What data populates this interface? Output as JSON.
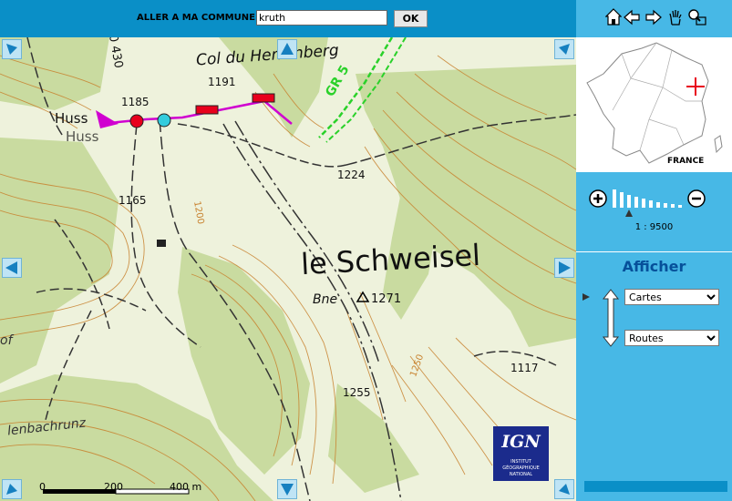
{
  "search": {
    "label": "ALLER A MA COMMUNE:",
    "value": "kruth",
    "ok_label": "OK"
  },
  "map": {
    "place_labels": {
      "col_du_herrenberg": "Col du Herrenberg",
      "le_schweisel": "le Schweisel",
      "bne": "Bne",
      "huss": "Huss",
      "huss2": "Huss",
      "gr5": "GR 5",
      "lenbachrunz": "lenbachrunz",
      "of": "of"
    },
    "elevations": {
      "e1185": "1185",
      "e1191": "1191",
      "e1224": "1224",
      "e1165": "1165",
      "e1271": "1271",
      "e1255": "1255",
      "e1117": "1117",
      "e1200": "1200",
      "e1250": "1250",
      "e430": "0 430"
    },
    "scalebar": {
      "l0": "0",
      "l200": "200",
      "l400": "400 m"
    },
    "ign": {
      "logo": "IGN",
      "line1": "INSTITUT",
      "line2": "GÉOGRAPHIQUE",
      "line3": "NATIONAL"
    }
  },
  "sidebar": {
    "overview_label": "FRANCE",
    "scale": "1 : 9500",
    "afficher_title": "Afficher",
    "layer1": {
      "selected": "Cartes",
      "options": [
        "Cartes"
      ]
    },
    "layer2": {
      "selected": "Routes",
      "options": [
        "Routes"
      ]
    }
  },
  "colors": {
    "topbar": "#0a8fc7",
    "sidebar": "#47b8e6",
    "forest": "#c9dba0",
    "contour": "#c8822f",
    "route_red": "#e8001c",
    "trail_magenta": "#d000d0",
    "gr_green": "#2ad12a",
    "title_blue": "#06509a"
  },
  "icons": [
    "home-icon",
    "pan-left-icon",
    "pan-right-icon",
    "hand-pan-icon",
    "zoom-box-icon",
    "zoom-in-icon",
    "zoom-out-icon",
    "nav-arrow-icon",
    "location-crosshair-icon"
  ]
}
